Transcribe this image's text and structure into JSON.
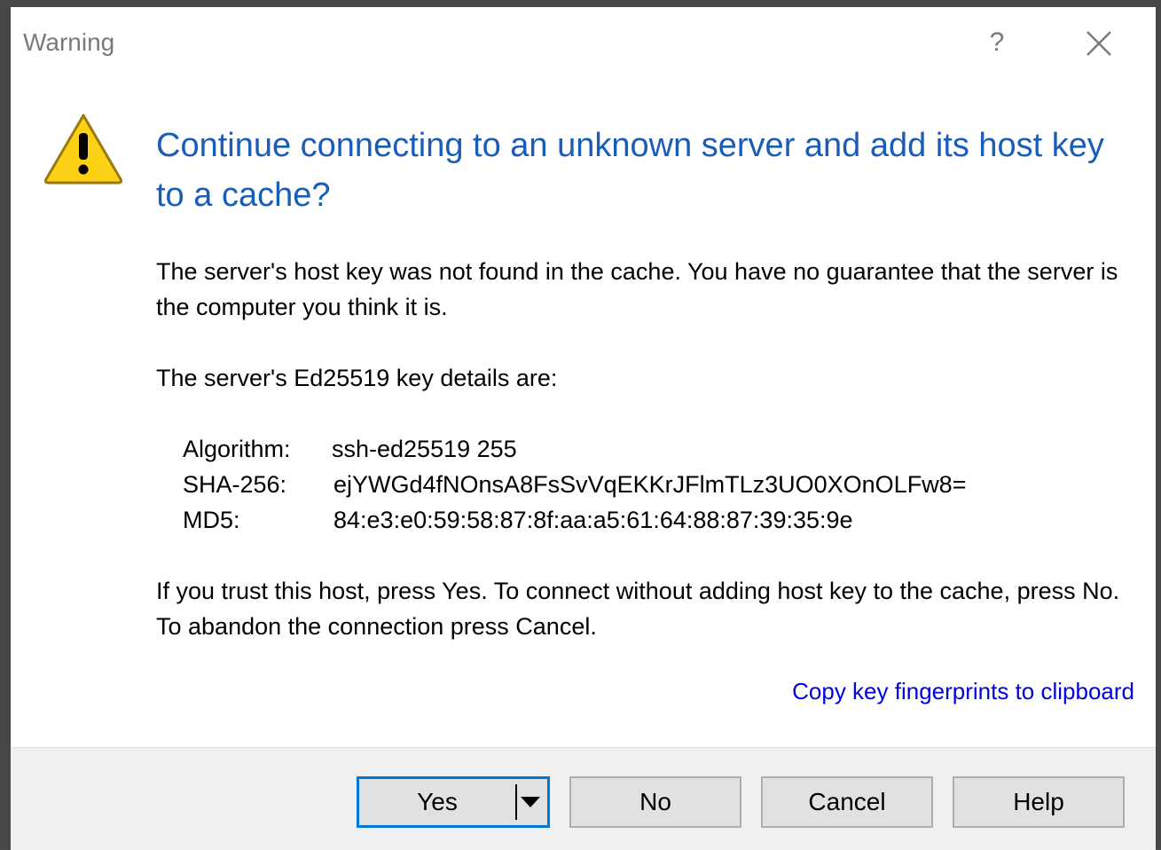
{
  "window": {
    "title": "Warning",
    "help_glyph": "?"
  },
  "icon": "warning-icon",
  "main_instruction": "Continue connecting to an unknown server and add its host key to a cache?",
  "paragraphs": {
    "p1": "The server's host key was not found in the cache. You have no guarantee that the server is the computer you think it is.",
    "p2": "The server's Ed25519 key details are:",
    "p4": "If you trust this host, press Yes. To connect without adding host key to the cache, press No. To abandon the connection press Cancel."
  },
  "key_details": [
    {
      "label": "Algorithm:",
      "value": "ssh-ed25519 255"
    },
    {
      "label": "SHA-256:",
      "value": "ejYWGd4fNOnsA8FsSvVqEKKrJFlmTLz3UO0XOnOLFw8="
    },
    {
      "label": "MD5:",
      "value": "84:e3:e0:59:58:87:8f:aa:a5:61:64:88:87:39:35:9e"
    }
  ],
  "link": "Copy key fingerprints to clipboard",
  "buttons": {
    "yes": "Yes",
    "no": "No",
    "cancel": "Cancel",
    "help": "Help"
  },
  "colors": {
    "instruction": "#1a5db8",
    "link": "#0000e0",
    "focus_border": "#0078d7",
    "warning_fill": "#fcd116"
  }
}
